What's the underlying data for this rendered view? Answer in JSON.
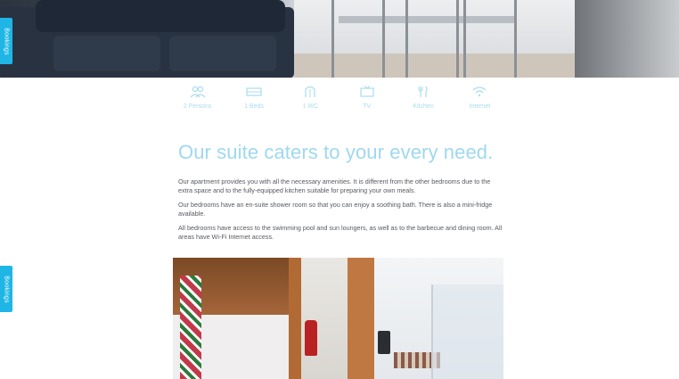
{
  "booking_tab": {
    "label": "Bookings",
    "color": "#1fb6e6"
  },
  "amenities": [
    {
      "icon": "persons-icon",
      "label": "2 Persons"
    },
    {
      "icon": "bed-icon",
      "label": "1 Beds"
    },
    {
      "icon": "bathroom-icon",
      "label": "1 WC"
    },
    {
      "icon": "tv-icon",
      "label": "TV"
    },
    {
      "icon": "kitchen-icon",
      "label": "Kitchen"
    },
    {
      "icon": "wifi-icon",
      "label": "Internet"
    }
  ],
  "content": {
    "headline": "Our suite caters to your every need.",
    "paragraphs": [
      "Our apartment provides you with all the necessary amenities. It is different from the other bedrooms due to the extra space and to the fully-equipped kitchen suitable for preparing your own meals.",
      "Our bedrooms have an en-suite shower room so that you can enjoy a soothing bath. There is also a mini-fridge available.",
      "All bedrooms have access to the swimming pool and sun loungers, as well as to the barbecue and dining room. All areas have Wi-Fi Internet access."
    ]
  },
  "colors": {
    "accent": "#9fd8ef",
    "tab": "#1fb6e6",
    "text": "#555a60"
  }
}
